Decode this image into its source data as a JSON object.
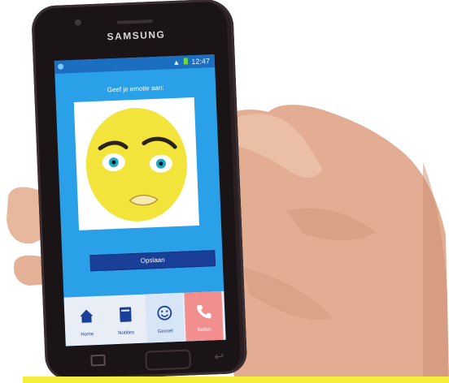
{
  "phone": {
    "brand": "SAMSUNG",
    "status_time": "12:47"
  },
  "app": {
    "prompt": "Geef je emotie aan:",
    "save_button": "Opslaan",
    "nav": [
      {
        "label": "Home",
        "icon": "home-icon"
      },
      {
        "label": "Notities",
        "icon": "notebook-icon"
      },
      {
        "label": "Gevoel",
        "icon": "smiley-icon"
      },
      {
        "label": "Bellen",
        "icon": "phone-icon"
      }
    ]
  },
  "colors": {
    "screen_bg": "#2aa0e8",
    "face_yellow": "#f3e43b",
    "button": "#1a3f98",
    "call_tab": "#f28e8e"
  }
}
